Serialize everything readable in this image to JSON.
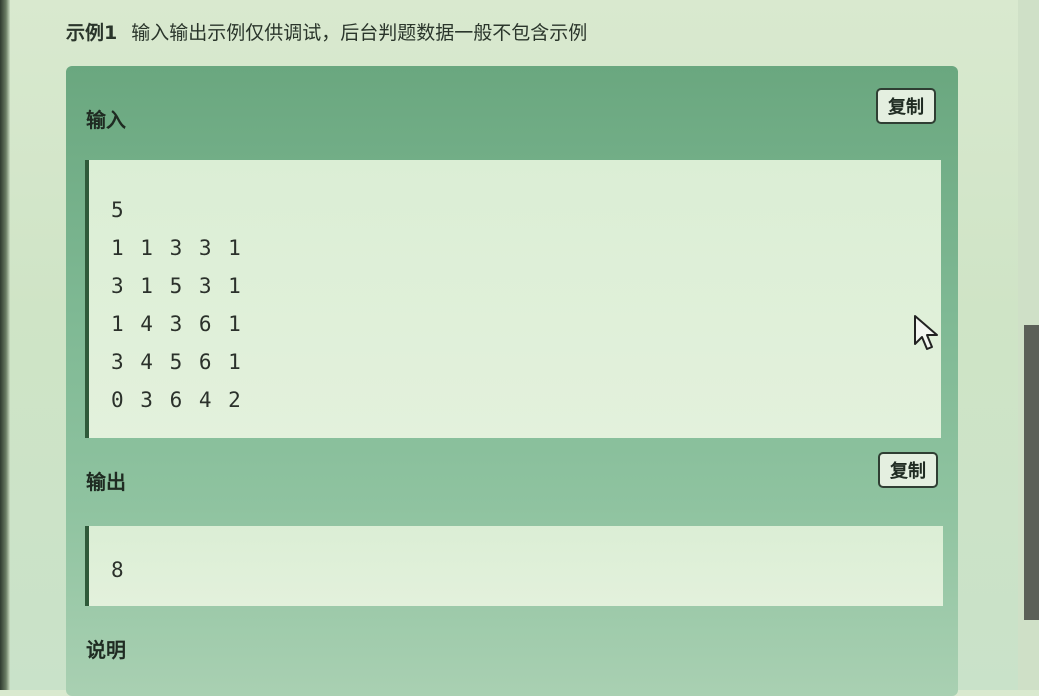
{
  "heading": {
    "label": "示例1",
    "note": "输入输出示例仅供调试，后台判题数据一般不包含示例"
  },
  "input_section": {
    "title": "输入",
    "copy_label": "复制",
    "lines": [
      "5",
      "1 1 3 3 1",
      "3 1 5 3 1",
      "1 4 3 6 1",
      "3 4 5 6 1",
      "0 3 6 4 2"
    ]
  },
  "output_section": {
    "title": "输出",
    "copy_label": "复制",
    "lines": [
      "8"
    ]
  },
  "explanation_section": {
    "title": "说明"
  },
  "icons": {
    "cursor": "mouse-pointer-icon"
  },
  "colors": {
    "panel": "#7fb994",
    "code_background": "#e0efd9",
    "code_border": "#2f5a3a"
  }
}
